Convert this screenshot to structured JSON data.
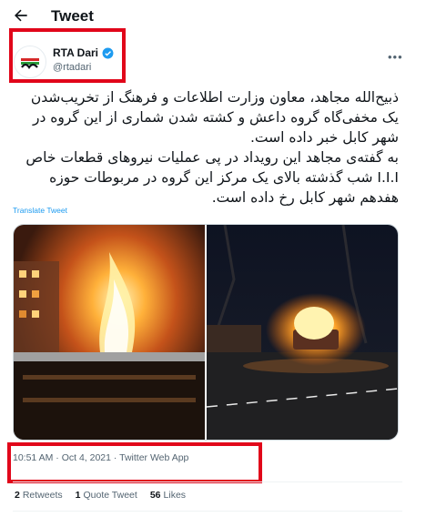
{
  "header": {
    "title": "Tweet"
  },
  "author": {
    "name": "RTA Dari",
    "handle": "@rtadari"
  },
  "tweet": {
    "paragraph1": "ذبیح‌الله مجاهد، معاون وزارت اطلاعات و فرهنگ از تخریب‌شدن یک مخفی‌گاه گروه داعش و کشته شدن شماری از این گروه در شهر کابل خبر داده است.",
    "paragraph2": "به گفته‌ی مجاهد این رویداد در پی عملیات نیروهای قطعات خاص I.I.I شب گذشته بالای یک مرکز این گروه در مربوطات حوزه هفدهم شهر کابل رخ داده است.",
    "translate_label": "Translate Tweet",
    "meta": "10:51 AM · Oct 4, 2021 · Twitter Web App"
  },
  "stats": {
    "retweets_count": "2",
    "retweets_label": "Retweets",
    "quotes_count": "1",
    "quotes_label": "Quote Tweet",
    "likes_count": "56",
    "likes_label": "Likes"
  },
  "colors": {
    "highlight": "#e1061a",
    "link": "#1d9bf0",
    "verified": "#1d9bf0"
  }
}
